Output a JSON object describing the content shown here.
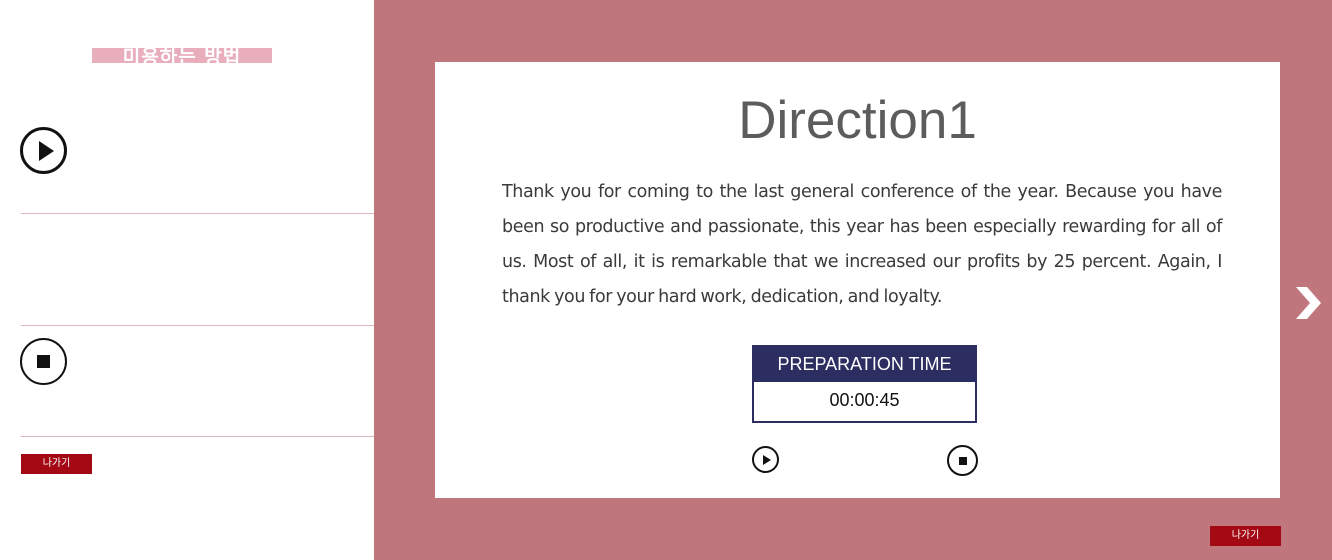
{
  "sidebar": {
    "title": "미용하는 방법",
    "play_icon": "play-icon",
    "stop_icon": "stop-icon",
    "exit_label": "나가기"
  },
  "main": {
    "heading": "Direction1",
    "paragraph": "Thank you for coming to the last general conference of the year. Because you have been so productive and passionate, this year has been especially rewarding for all of us. Most of all, it is remarkable that we increased our profits by 25 percent. Again, I thank you for your hard work, dedication, and loyalty.",
    "timer": {
      "label": "PREPARATION TIME",
      "value": "00:00:45"
    },
    "play_icon": "play-icon",
    "stop_icon": "stop-icon",
    "next_icon": "chevron-right-icon",
    "exit_label": "나가기"
  },
  "colors": {
    "background_rose": "#bf777d",
    "sidebar_title_bar": "#e8aebb",
    "timer_navy": "#2c2e62",
    "exit_red": "#a30a14",
    "divider_pink": "#dbb6c0"
  }
}
